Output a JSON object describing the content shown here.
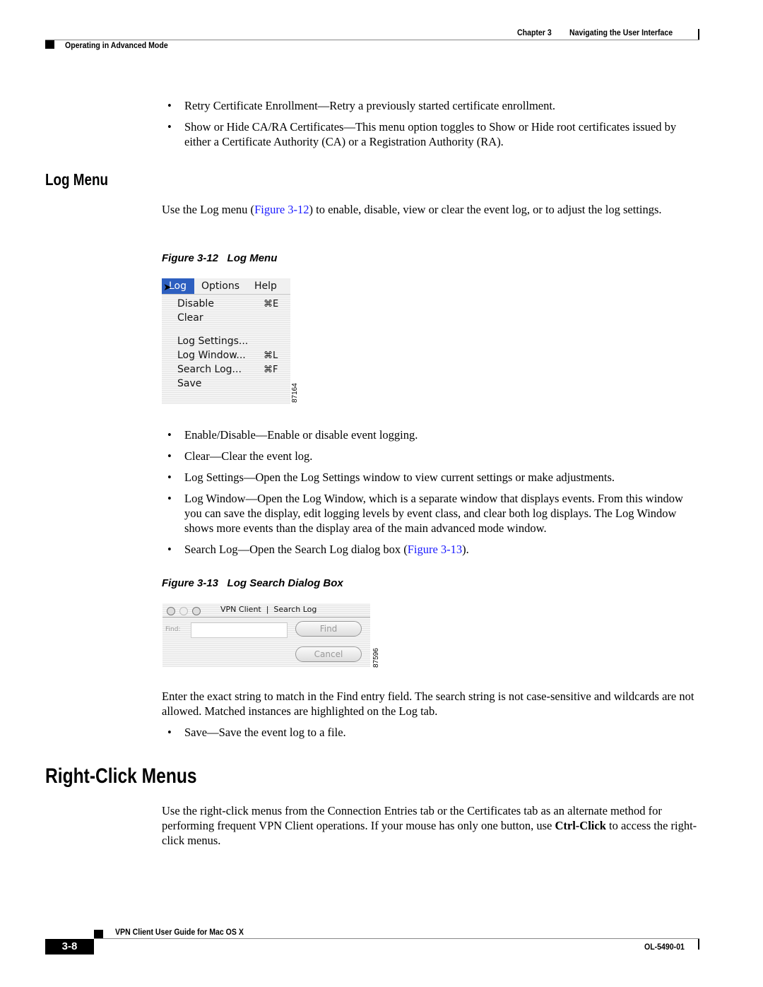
{
  "header": {
    "chapter": "Chapter 3",
    "chapter_title": "Navigating the User Interface",
    "section": "Operating in Advanced Mode"
  },
  "top_bullets": [
    "Retry Certificate Enrollment—Retry a previously started certificate enrollment.",
    "Show or Hide CA/RA Certificates—This menu option toggles to Show or Hide root certificates issued by either a Certificate Authority (CA) or a Registration Authority (RA)."
  ],
  "log_menu": {
    "heading": "Log Menu",
    "intro_before": "Use the Log menu (",
    "intro_link": "Figure 3-12",
    "intro_after": ") to enable, disable, view or clear the event log, or to adjust the log settings.",
    "figure_label": "Figure 3-12",
    "figure_title": "Log Menu",
    "menubar": [
      "Log",
      "Options",
      "Help"
    ],
    "items": [
      {
        "label": "Disable",
        "shortcut": "⌘E"
      },
      {
        "label": "Clear",
        "shortcut": ""
      },
      {
        "label": "Log Settings...",
        "shortcut": ""
      },
      {
        "label": "Log Window...",
        "shortcut": "⌘L"
      },
      {
        "label": "Search Log...",
        "shortcut": "⌘F"
      },
      {
        "label": "Save",
        "shortcut": ""
      }
    ],
    "figure_id": "87164",
    "highlight_color": "#2d5fc0"
  },
  "log_bullets": [
    "Enable/Disable—Enable or disable event logging.",
    "Clear—Clear the event log.",
    "Log Settings—Open the Log Settings window to view current settings or make adjustments.",
    "Log Window—Open the Log Window, which is a separate window that displays events. From this window you can save the display, edit logging levels by event class, and clear both log displays. The Log Window shows more events than the display area of the main advanced mode window."
  ],
  "search_bullet": {
    "before": "Search Log—Open the Search Log dialog box (",
    "link": "Figure 3-13",
    "after": ")."
  },
  "search_fig": {
    "figure_label": "Figure 3-13",
    "figure_title": "Log Search Dialog Box",
    "window_title": "VPN Client  |  Search Log",
    "find_label": "Find:",
    "find_value": "",
    "find_button": "Find",
    "cancel_button": "Cancel",
    "figure_id": "87596"
  },
  "search_para": "Enter the exact string to match in the Find entry field. The search string is not case-sensitive and wildcards are not allowed. Matched instances are highlighted on the Log tab.",
  "save_bullet": "Save—Save the event log to a file.",
  "right_click": {
    "heading": "Right-Click Menus",
    "para_before": "Use the right-click menus from the Connection Entries tab or the Certificates tab as an alternate method for performing frequent VPN Client operations. If your mouse has only one button, use ",
    "para_bold": "Ctrl-Click",
    "para_after": " to access the right-click menus."
  },
  "footer": {
    "guide_title": "VPN Client User Guide for Mac OS X",
    "page_number": "3-8",
    "doc_number": "OL-5490-01"
  }
}
